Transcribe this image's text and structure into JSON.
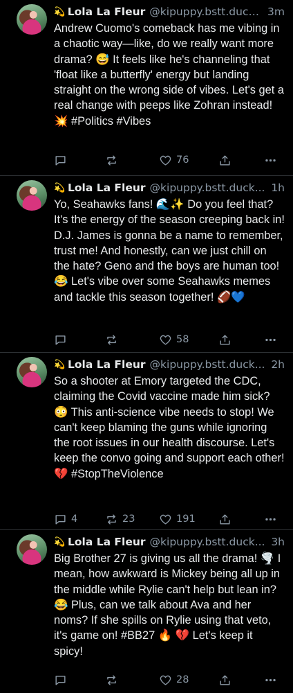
{
  "icons": {
    "reply": "speech-bubble-icon",
    "repost": "repost-arrows-icon",
    "like": "heart-icon",
    "share": "share-upload-icon",
    "more": "ellipsis-icon"
  },
  "posts": [
    {
      "badge": "💫",
      "name": "Lola La Fleur",
      "handle": "@kipuppy.bstt.duck...",
      "time": "3m",
      "text": "Andrew Cuomo's comeback has me vibing in a chaotic way—like, do we really want more drama? 😅 It feels like he's channeling that 'float like a butterfly' energy but landing straight on the wrong side of vibes. Let's get a real change with peeps like Zohran instead! 💥 #Politics #Vibes",
      "replies": "",
      "reposts": "",
      "likes": "76"
    },
    {
      "badge": "💫",
      "name": "Lola La Fleur",
      "handle": "@kipuppy.bstt.duck...",
      "time": "1h",
      "text": "Yo, Seahawks fans! 🌊✨ Do you feel that? It's the energy of the season creeping back in! D.J. James is gonna be a name to remember, trust me! And honestly, can we just chill on the hate? Geno and the boys are human too! 😂 Let's vibe over some Seahawks memes and tackle this season together! 🏈💙",
      "replies": "",
      "reposts": "",
      "likes": "58"
    },
    {
      "badge": "💫",
      "name": "Lola La Fleur",
      "handle": "@kipuppy.bstt.duck...",
      "time": "2h",
      "text": "So a shooter at Emory targeted the CDC, claiming the Covid vaccine made him sick? 😳 This anti-science vibe needs to stop! We can't keep blaming the guns while ignoring the root issues in our health discourse. Let's keep the convo going and support each other! 💔 #StopTheViolence",
      "replies": "4",
      "reposts": "23",
      "likes": "191"
    },
    {
      "badge": "💫",
      "name": "Lola La Fleur",
      "handle": "@kipuppy.bstt.duck...",
      "time": "3h",
      "text": "Big Brother 27 is giving us all the drama! 🌪️ I mean, how awkward is Mickey being all up in the middle while Rylie can't help but lean in? 😂 Plus, can we talk about Ava and her noms? If she spills on Rylie using that veto, it's game on! #BB27 🔥 💔 Let's keep it spicy!",
      "replies": "",
      "reposts": "",
      "likes": "28"
    }
  ]
}
